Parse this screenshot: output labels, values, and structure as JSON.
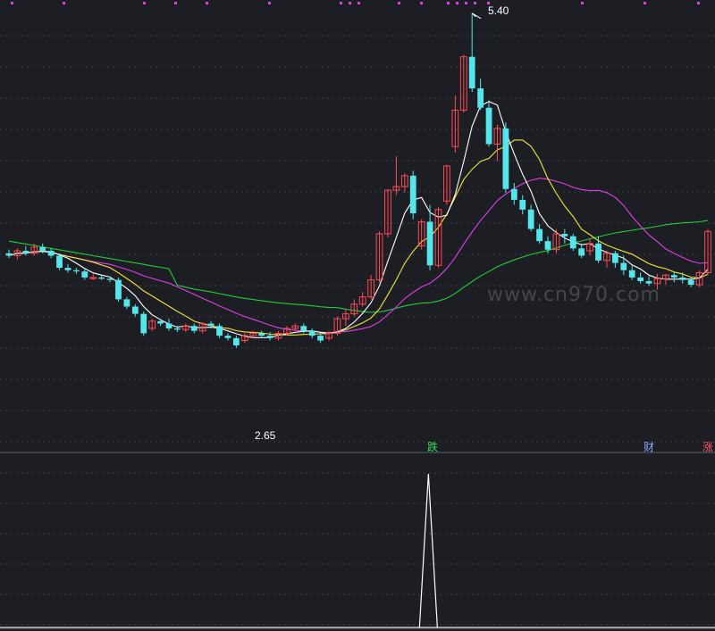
{
  "watermark": "www.cn970.com",
  "annotations": {
    "high_label": "5.40",
    "low_label": "2.65"
  },
  "event_tags": [
    {
      "text": "跌",
      "color": "#33dd55"
    },
    {
      "text": "财",
      "color": "#88aaff"
    },
    {
      "text": "涨",
      "color": "#ff5566"
    }
  ],
  "colors": {
    "background": "#1c1e24",
    "grid": "#3a3d48",
    "up": "#ff4a55",
    "down": "#54e6ea",
    "ma5": "#ffffff",
    "ma10": "#f2e43a",
    "ma20": "#e040e8",
    "ma60": "#22cc33",
    "top_dots": "#e040e8",
    "signal": "#ffffff"
  },
  "chart_data": {
    "type": "candlestick",
    "price_range": [
      1.85,
      5.45
    ],
    "grid": true,
    "high": 5.4,
    "low": 2.65,
    "candles": [
      [
        3.42,
        3.45,
        3.38,
        3.4
      ],
      [
        3.4,
        3.46,
        3.37,
        3.44
      ],
      [
        3.44,
        3.48,
        3.4,
        3.42
      ],
      [
        3.42,
        3.5,
        3.4,
        3.47
      ],
      [
        3.47,
        3.5,
        3.42,
        3.44
      ],
      [
        3.44,
        3.46,
        3.38,
        3.4
      ],
      [
        3.4,
        3.42,
        3.28,
        3.3
      ],
      [
        3.3,
        3.33,
        3.26,
        3.28
      ],
      [
        3.28,
        3.3,
        3.25,
        3.27
      ],
      [
        3.27,
        3.3,
        3.2,
        3.22
      ],
      [
        3.22,
        3.25,
        3.2,
        3.22
      ],
      [
        3.22,
        3.24,
        3.2,
        3.21
      ],
      [
        3.21,
        3.23,
        3.18,
        3.2
      ],
      [
        3.2,
        3.22,
        3.02,
        3.04
      ],
      [
        3.04,
        3.06,
        2.96,
        2.98
      ],
      [
        2.98,
        3.0,
        2.9,
        2.92
      ],
      [
        2.92,
        2.94,
        2.74,
        2.76
      ],
      [
        2.8,
        2.88,
        2.78,
        2.86
      ],
      [
        2.86,
        2.88,
        2.82,
        2.84
      ],
      [
        2.84,
        2.88,
        2.78,
        2.8
      ],
      [
        2.8,
        2.82,
        2.77,
        2.79
      ],
      [
        2.79,
        2.84,
        2.77,
        2.82
      ],
      [
        2.82,
        2.84,
        2.76,
        2.78
      ],
      [
        2.78,
        2.85,
        2.76,
        2.84
      ],
      [
        2.84,
        2.86,
        2.8,
        2.82
      ],
      [
        2.82,
        2.84,
        2.72,
        2.74
      ],
      [
        2.74,
        2.76,
        2.7,
        2.72
      ],
      [
        2.72,
        2.74,
        2.64,
        2.66
      ],
      [
        2.7,
        2.76,
        2.68,
        2.74
      ],
      [
        2.74,
        2.78,
        2.72,
        2.76
      ],
      [
        2.76,
        2.78,
        2.72,
        2.74
      ],
      [
        2.74,
        2.77,
        2.7,
        2.72
      ],
      [
        2.72,
        2.78,
        2.7,
        2.76
      ],
      [
        2.76,
        2.82,
        2.74,
        2.8
      ],
      [
        2.8,
        2.84,
        2.78,
        2.82
      ],
      [
        2.82,
        2.84,
        2.76,
        2.78
      ],
      [
        2.78,
        2.8,
        2.72,
        2.74
      ],
      [
        2.74,
        2.76,
        2.68,
        2.7
      ],
      [
        2.72,
        2.78,
        2.7,
        2.76
      ],
      [
        2.76,
        2.9,
        2.74,
        2.88
      ],
      [
        2.88,
        2.96,
        2.82,
        2.92
      ],
      [
        2.92,
        3.04,
        2.9,
        3.0
      ],
      [
        3.0,
        3.1,
        2.98,
        3.06
      ],
      [
        3.06,
        3.24,
        3.04,
        3.2
      ],
      [
        3.2,
        3.6,
        3.18,
        3.58
      ],
      [
        3.58,
        3.95,
        3.55,
        3.94
      ],
      [
        3.94,
        4.22,
        3.9,
        3.97
      ],
      [
        3.97,
        4.08,
        3.92,
        4.06
      ],
      [
        4.06,
        4.1,
        3.7,
        3.75
      ],
      [
        3.48,
        3.7,
        3.45,
        3.68
      ],
      [
        3.68,
        3.82,
        3.28,
        3.32
      ],
      [
        3.32,
        3.8,
        3.3,
        3.78
      ],
      [
        3.85,
        4.15,
        3.82,
        4.14
      ],
      [
        4.3,
        4.72,
        4.25,
        4.6
      ],
      [
        4.6,
        5.06,
        4.58,
        5.04
      ],
      [
        5.04,
        5.4,
        4.75,
        4.78
      ],
      [
        4.78,
        4.86,
        4.6,
        4.62
      ],
      [
        4.62,
        4.68,
        4.3,
        4.32
      ],
      [
        4.32,
        4.48,
        4.18,
        4.45
      ],
      [
        4.45,
        4.5,
        3.92,
        3.95
      ],
      [
        3.95,
        4.0,
        3.82,
        3.86
      ],
      [
        3.86,
        3.9,
        3.74,
        3.78
      ],
      [
        3.78,
        3.82,
        3.6,
        3.62
      ],
      [
        3.62,
        3.66,
        3.5,
        3.52
      ],
      [
        3.52,
        3.56,
        3.42,
        3.45
      ],
      [
        3.45,
        3.62,
        3.42,
        3.58
      ],
      [
        3.58,
        3.62,
        3.5,
        3.56
      ],
      [
        3.56,
        3.58,
        3.44,
        3.46
      ],
      [
        3.46,
        3.5,
        3.38,
        3.4
      ],
      [
        3.44,
        3.54,
        3.4,
        3.5
      ],
      [
        3.5,
        3.56,
        3.34,
        3.36
      ],
      [
        3.36,
        3.44,
        3.3,
        3.42
      ],
      [
        3.42,
        3.44,
        3.3,
        3.34
      ],
      [
        3.34,
        3.4,
        3.24,
        3.28
      ],
      [
        3.28,
        3.32,
        3.2,
        3.22
      ],
      [
        3.22,
        3.26,
        3.17,
        3.19
      ],
      [
        3.19,
        3.23,
        3.15,
        3.17
      ],
      [
        3.17,
        3.25,
        3.12,
        3.21
      ],
      [
        3.21,
        3.25,
        3.16,
        3.24
      ],
      [
        3.24,
        3.27,
        3.18,
        3.22
      ],
      [
        3.22,
        3.26,
        3.17,
        3.2
      ],
      [
        3.2,
        3.22,
        3.14,
        3.16
      ],
      [
        3.16,
        3.28,
        3.14,
        3.26
      ],
      [
        3.26,
        3.62,
        3.24,
        3.6
      ]
    ],
    "signal_peak_index": 53
  }
}
